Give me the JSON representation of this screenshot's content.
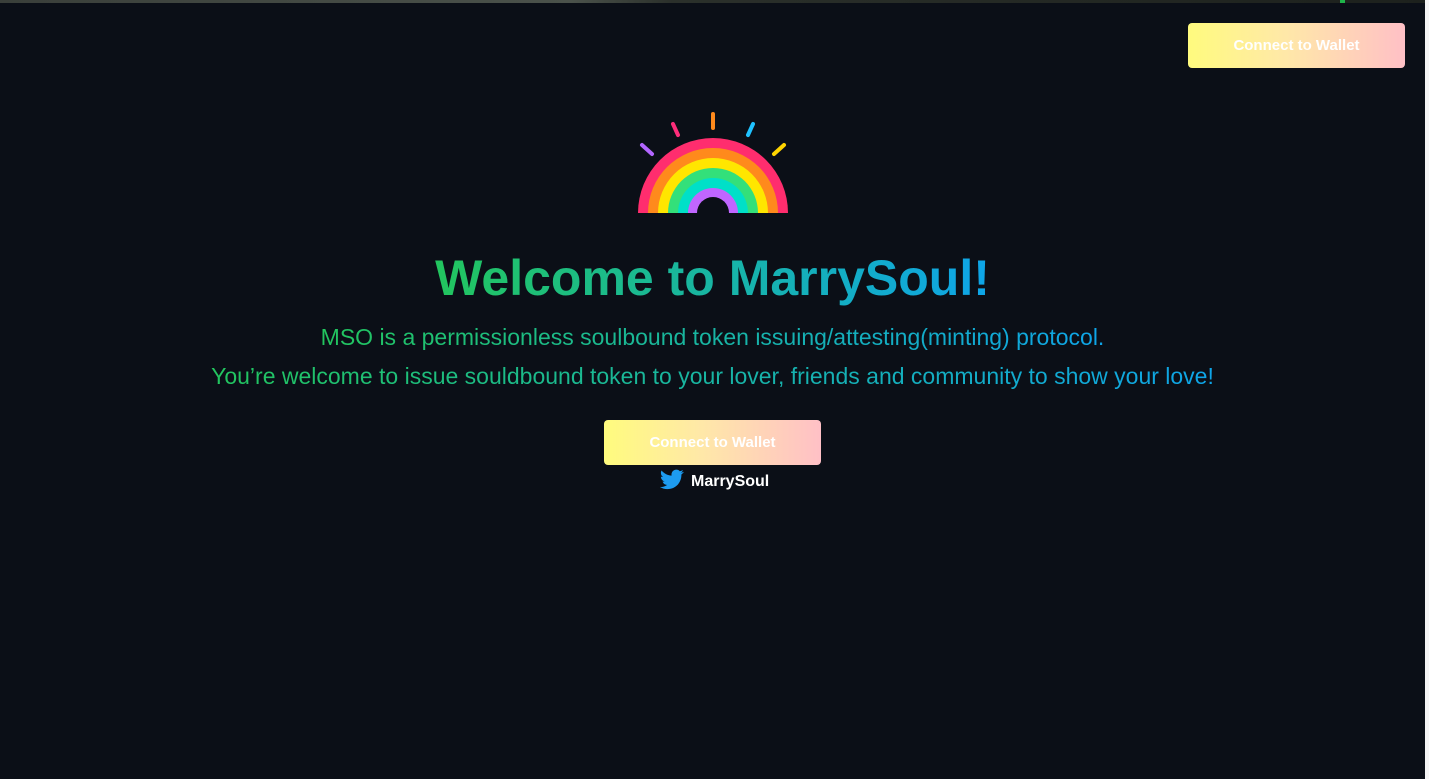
{
  "header": {
    "connect_label": "Connect to Wallet"
  },
  "hero": {
    "title": "Welcome to MarrySoul!",
    "subtitle_line1": "MSO is a permissionless soulbound token issuing/attesting(minting) protocol.",
    "subtitle_line2": "You’re welcome to issue souldbound token to your lover, friends and community to show your love!",
    "connect_label": "Connect to Wallet",
    "logo_icon": "rainbow-icon"
  },
  "social": {
    "twitter_label": "MarrySoul",
    "icon": "twitter-icon"
  },
  "colors": {
    "background": "#0b0f17",
    "gradient_green": "#22c55e",
    "gradient_blue": "#0ea5e9",
    "button_yellow": "#fffb7e",
    "button_pink": "#ffc0c6",
    "twitter_blue": "#1d9bf0"
  }
}
